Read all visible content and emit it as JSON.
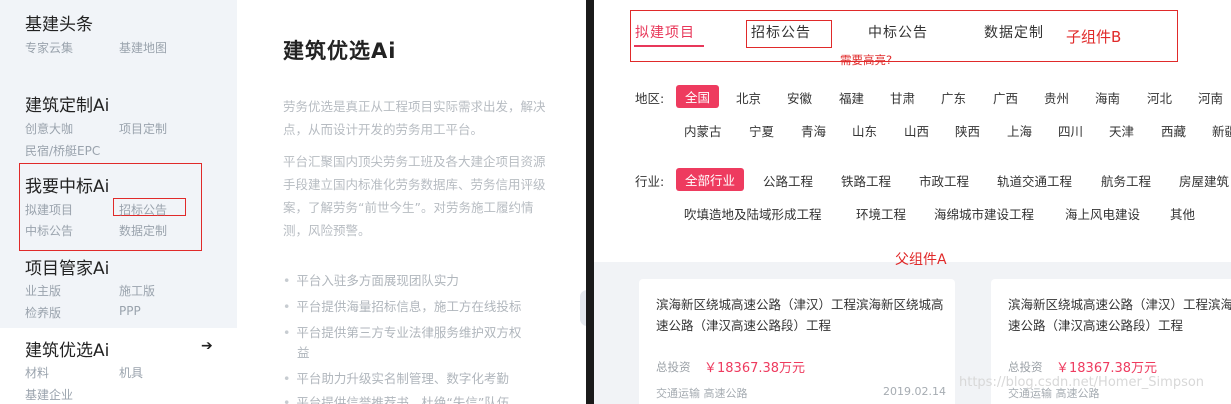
{
  "left": {
    "menu": [
      {
        "title": "基建头条",
        "items": [
          "专家云集",
          "基建地图"
        ]
      },
      {
        "title": "建筑定制Ai",
        "items": [
          "创意大咖",
          "项目定制",
          "民宿/桥艇EPC"
        ]
      },
      {
        "title": "我要中标Ai",
        "items": [
          "拟建项目",
          "招标公告",
          "中标公告",
          "数据定制"
        ]
      },
      {
        "title": "项目管家Ai",
        "items": [
          "业主版",
          "施工版",
          "检养版",
          "PPP"
        ]
      },
      {
        "title": "建筑优选Ai",
        "items": [
          "材料",
          "机具",
          "基建企业"
        ]
      }
    ],
    "arrow": "➔",
    "detail": {
      "title": "建筑优选Ai",
      "para1": [
        "劳务优选是真正从工程项目实际需求出发，解决",
        "点，从而设计开发的劳务用工平台。"
      ],
      "para2": [
        "平台汇聚国内顶尖劳务工班及各大建企项目资源",
        "手段建立国内标准化劳务数据库、劳务信用评级",
        "案，了解劳务“前世今生”。对劳务施工履约情",
        "测，风险预警。"
      ],
      "bullets": [
        "平台入驻多方面展现团队实力",
        "平台提供海量招标信息，施工方在线投标",
        "平台提供第三方专业法律服务维护双方权",
        "益",
        "平台助力升级实名制管理、数字化考勤",
        "平台提供信誉推荐书，杜绝“失信”队伍"
      ]
    }
  },
  "right": {
    "tabs": [
      "拟建项目",
      "招标公告",
      "中标公告",
      "数据定制"
    ],
    "active_tab": 0,
    "annotations": {
      "child_b": "子组件B",
      "need_highlight": "需要高亮?",
      "parent_a": "父组件A"
    },
    "region": {
      "label": "地区:",
      "row1": [
        "全国",
        "北京",
        "安徽",
        "福建",
        "甘肃",
        "广东",
        "广西",
        "贵州",
        "海南",
        "河北",
        "河南"
      ],
      "row2": [
        "内蒙古",
        "宁夏",
        "青海",
        "山东",
        "山西",
        "陕西",
        "上海",
        "四川",
        "天津",
        "西藏",
        "新疆"
      ]
    },
    "industry": {
      "label": "行业:",
      "row1": [
        "全部行业",
        "公路工程",
        "铁路工程",
        "市政工程",
        "轨道交通工程",
        "航务工程",
        "房屋建筑"
      ],
      "row2": [
        "吹填造地及陆域形成工程",
        "环境工程",
        "海绵城市建设工程",
        "海上风电建设",
        "其他"
      ]
    },
    "cards": [
      {
        "title": "滨海新区绕城高速公路（津汉）工程滨海新区绕城高速公路（津汉高速公路段）工程",
        "invest_label": "总投资",
        "invest_value": "￥18367.38万元",
        "category": "交通运输  高速公路",
        "date": "2019.02.14"
      },
      {
        "title": "滨海新区绕城高速公路（津汉）工程滨海新区绕城高速公路（津汉高速公路段）工程",
        "invest_label": "总投资",
        "invest_value": "￥18367.38万元",
        "category": "交通运输  高速公路",
        "date": ""
      }
    ],
    "watermark": "https://blog.csdn.net/Homer_Simpson"
  },
  "colors": {
    "accent": "#ee3b5f",
    "annotation": "#e02a2a",
    "menu_bg": "#f1f4f8",
    "muted": "#9aa3ad"
  }
}
